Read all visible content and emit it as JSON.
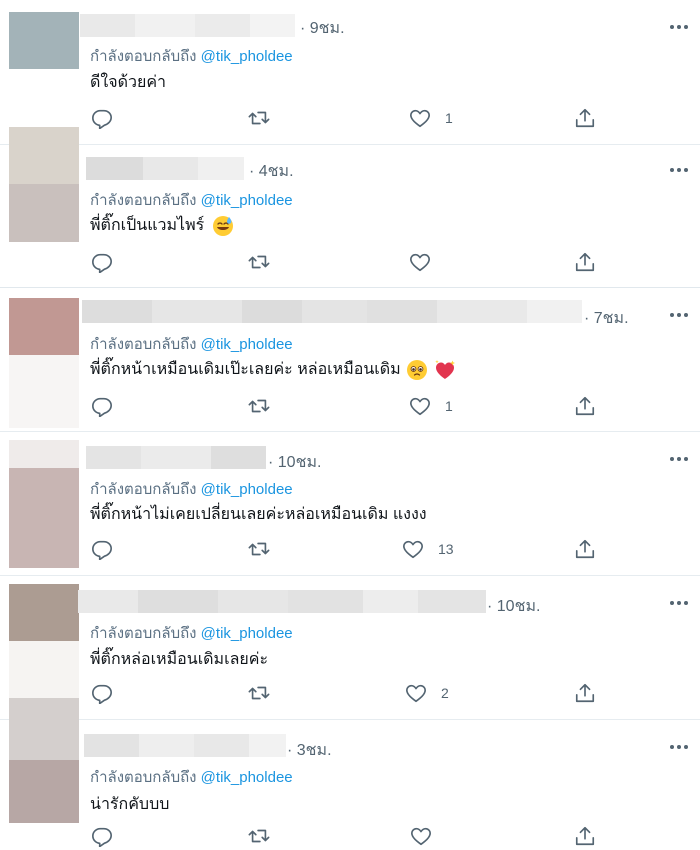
{
  "reply_prefix": "กำลังตอบกลับถึง",
  "tweets": [
    {
      "time": "9ชม.",
      "handle": "@tik_pholdee",
      "text": "ดีใจด้วยค่า",
      "likes": "1"
    },
    {
      "time": "4ชม.",
      "handle": "@tik_pholdee",
      "text": "พี่ติ๊กเป็นแวมไพร์",
      "likes": ""
    },
    {
      "time": "7ชม.",
      "handle": "@tik_pholdee",
      "text": "พี่ติ๊กหน้าเหมือนเดิมเป๊ะเลยค่ะ หล่อเหมือนเดิม",
      "likes": "1"
    },
    {
      "time": "10ชม.",
      "handle": "@tik_pholdee",
      "text": "พี่ติ๊กหน้าไม่เคยเปลี่ยนเลยค่ะหล่อเหมือนเดิม แงงง",
      "likes": "13"
    },
    {
      "time": "10ชม.",
      "handle": "@tik_pholdee",
      "text": "พี่ติ๊กหล่อเหมือนเดิมเลยค่ะ",
      "likes": "2"
    },
    {
      "time": "3ชม.",
      "handle": "@tik_pholdee",
      "text": "น่ารักคับบบ",
      "likes": ""
    }
  ],
  "icons": {
    "reply": "reply-icon",
    "retweet": "retweet-icon",
    "like": "heart-icon",
    "share": "share-icon",
    "more": "more-icon",
    "emoji_sweat": "sweat-smile-emoji",
    "emoji_pleading": "pleading-face-emoji",
    "emoji_heart": "sparkling-heart-emoji"
  },
  "colors": {
    "handle": "#1b95e0",
    "secondary_text": "#5b7083",
    "divider": "#e6ecf0"
  }
}
